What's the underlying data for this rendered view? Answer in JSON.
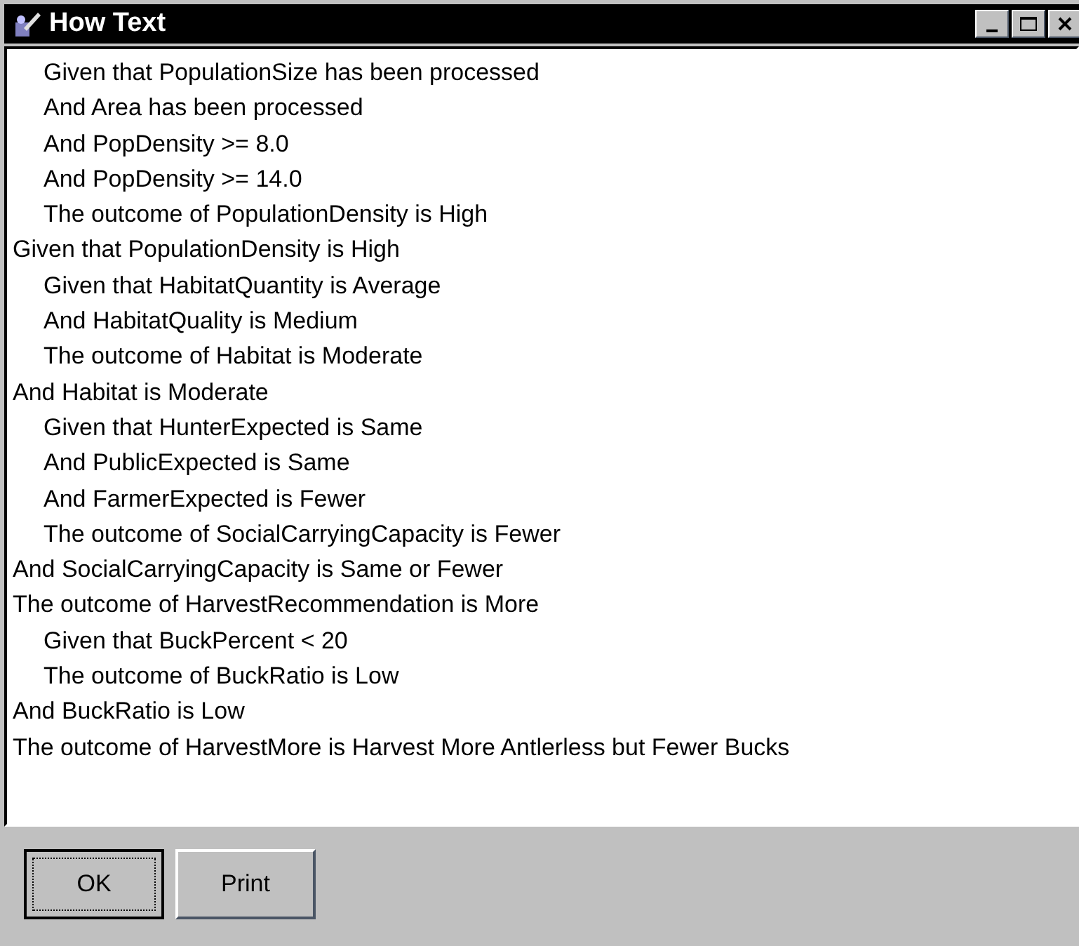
{
  "window": {
    "title": "How Text"
  },
  "lines": [
    {
      "children": [
        {
          "text": "Given that PopulationSize has been processed"
        },
        {
          "text": "And Area has been processed"
        },
        {
          "text": "And PopDensity >= 8.0"
        },
        {
          "text": "And PopDensity >= 14.0"
        },
        {
          "text": "The outcome of PopulationDensity is High"
        }
      ]
    },
    {
      "text": "Given that PopulationDensity is High"
    },
    {
      "children": [
        {
          "text": "Given that HabitatQuantity is Average"
        },
        {
          "text": "And HabitatQuality is Medium"
        },
        {
          "text": "The outcome of Habitat is Moderate"
        }
      ]
    },
    {
      "text": "And Habitat is Moderate"
    },
    {
      "children": [
        {
          "text": "Given that HunterExpected is Same"
        },
        {
          "text": "And PublicExpected is Same"
        },
        {
          "text": "And FarmerExpected is Fewer"
        },
        {
          "text": "The outcome of SocialCarryingCapacity is Fewer"
        }
      ]
    },
    {
      "text": "And SocialCarryingCapacity is Same or Fewer"
    },
    {
      "text": "The outcome of HarvestRecommendation is More"
    },
    {
      "children": [
        {
          "text": "Given that BuckPercent < 20"
        },
        {
          "text": "The outcome of BuckRatio is Low"
        }
      ]
    },
    {
      "text": "And BuckRatio is Low"
    },
    {
      "text": "The outcome of HarvestMore is Harvest More Antlerless but Fewer Bucks"
    }
  ],
  "buttons": [
    {
      "label": "OK",
      "selected": true
    },
    {
      "label": "Print",
      "selected": false
    }
  ]
}
